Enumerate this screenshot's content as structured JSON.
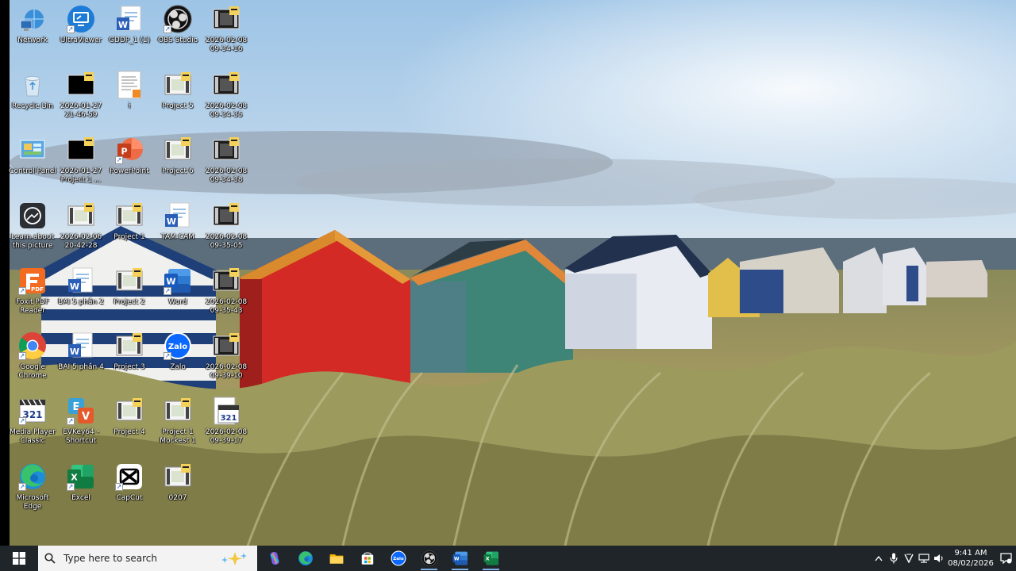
{
  "desktop": {
    "icons": [
      {
        "name": "network",
        "label": "Network",
        "kind": "network",
        "col": 0,
        "row": 0
      },
      {
        "name": "ultraviewer",
        "label": "UltraViewer",
        "kind": "ultraviewer",
        "col": 1,
        "row": 0,
        "shortcut": true
      },
      {
        "name": "gddp",
        "label": "GDDP_1 (1)",
        "kind": "word",
        "col": 2,
        "row": 0
      },
      {
        "name": "obs-studio",
        "label": "OBS Studio",
        "kind": "obs",
        "col": 3,
        "row": 0,
        "shortcut": true
      },
      {
        "name": "video-0908-34-16",
        "label": "2026-02-08 09-34-16",
        "kind": "video-dark",
        "col": 4,
        "row": 0
      },
      {
        "name": "recycle-bin",
        "label": "Recycle Bin",
        "kind": "recycle",
        "col": 0,
        "row": 1
      },
      {
        "name": "video-0127-21-46",
        "label": "2026-01-27 21-46-59",
        "kind": "video-black",
        "col": 1,
        "row": 1
      },
      {
        "name": "doc-i",
        "label": "i",
        "kind": "doc",
        "col": 2,
        "row": 1
      },
      {
        "name": "project-5",
        "label": "Project 5",
        "kind": "video-light",
        "col": 3,
        "row": 1
      },
      {
        "name": "video-0908-34-35",
        "label": "2026-02-08 09-34-35",
        "kind": "video-dark",
        "col": 4,
        "row": 1
      },
      {
        "name": "control-panel",
        "label": "Control Panel",
        "kind": "control",
        "col": 0,
        "row": 2
      },
      {
        "name": "video-0127-project1",
        "label": "2026-01-27 Project 1 ...",
        "kind": "video-black",
        "col": 1,
        "row": 2
      },
      {
        "name": "powerpoint",
        "label": "PowerPoint",
        "kind": "powerpoint",
        "col": 2,
        "row": 2,
        "shortcut": true
      },
      {
        "name": "project-6",
        "label": "Project 6",
        "kind": "video-light",
        "col": 3,
        "row": 2
      },
      {
        "name": "video-0908-34-38",
        "label": "2026-02-08 09-34-38",
        "kind": "video-dark",
        "col": 4,
        "row": 2
      },
      {
        "name": "learn-about-picture",
        "label": "Learn about this picture",
        "kind": "learn",
        "col": 0,
        "row": 3
      },
      {
        "name": "video-0206-20-42",
        "label": "2026-02-06 20-42-28",
        "kind": "video-light",
        "col": 1,
        "row": 3
      },
      {
        "name": "project-1",
        "label": "Project 1",
        "kind": "video-light",
        "col": 2,
        "row": 3
      },
      {
        "name": "tam-cam",
        "label": "TAM CAM",
        "kind": "word",
        "col": 3,
        "row": 3
      },
      {
        "name": "video-0908-35-05",
        "label": "2026-02-08 09-35-05",
        "kind": "video-dark",
        "col": 4,
        "row": 3
      },
      {
        "name": "foxit-pdf",
        "label": "Foxit PDF Reader",
        "kind": "foxit",
        "col": 0,
        "row": 4,
        "shortcut": true
      },
      {
        "name": "bai5-phan2",
        "label": "BAI 5 phần 2",
        "kind": "word",
        "col": 1,
        "row": 4
      },
      {
        "name": "project-2",
        "label": "Project 2",
        "kind": "video-light",
        "col": 2,
        "row": 4
      },
      {
        "name": "word",
        "label": "Word",
        "kind": "word-app",
        "col": 3,
        "row": 4,
        "shortcut": true
      },
      {
        "name": "video-0908-35-43",
        "label": "2026-02-08 09-35-43",
        "kind": "video-dark",
        "col": 4,
        "row": 4
      },
      {
        "name": "google-chrome",
        "label": "Google Chrome",
        "kind": "chrome",
        "col": 0,
        "row": 5,
        "shortcut": true
      },
      {
        "name": "bai5-phan4",
        "label": "BAI 5 phần 4",
        "kind": "word",
        "col": 1,
        "row": 5
      },
      {
        "name": "project-3",
        "label": "Project 3",
        "kind": "video-light",
        "col": 2,
        "row": 5
      },
      {
        "name": "zalo",
        "label": "Zalo",
        "kind": "zalo",
        "col": 3,
        "row": 5,
        "shortcut": true
      },
      {
        "name": "video-0908-39-10",
        "label": "2026-02-08 09-39-10",
        "kind": "video-dark",
        "col": 4,
        "row": 5
      },
      {
        "name": "media-player-classic",
        "label": "Media Player Classic",
        "kind": "mpc",
        "col": 0,
        "row": 6,
        "shortcut": true
      },
      {
        "name": "evkey64",
        "label": "EVKey64 - Shortcut",
        "kind": "evkey",
        "col": 1,
        "row": 6,
        "shortcut": true
      },
      {
        "name": "project-4",
        "label": "Project 4",
        "kind": "video-light",
        "col": 2,
        "row": 6
      },
      {
        "name": "project-1-mockest",
        "label": "Project 1 Mockest 1",
        "kind": "video-light",
        "col": 3,
        "row": 6
      },
      {
        "name": "video-0908-39-17",
        "label": "2026-02-08 09-39-17",
        "kind": "mpc-file",
        "col": 4,
        "row": 6
      },
      {
        "name": "microsoft-edge",
        "label": "Microsoft Edge",
        "kind": "edge",
        "col": 0,
        "row": 7,
        "shortcut": true
      },
      {
        "name": "excel",
        "label": "Excel",
        "kind": "excel",
        "col": 1,
        "row": 7,
        "shortcut": true
      },
      {
        "name": "capcut",
        "label": "CapCut",
        "kind": "capcut",
        "col": 2,
        "row": 7,
        "shortcut": true
      },
      {
        "name": "file-0207",
        "label": "0207",
        "kind": "video-light",
        "col": 3,
        "row": 7
      }
    ]
  },
  "taskbar": {
    "search_placeholder": "Type here to search",
    "apps": [
      {
        "name": "copilot",
        "kind": "copilot",
        "active": false
      },
      {
        "name": "edge",
        "kind": "edge",
        "active": false
      },
      {
        "name": "file-explorer",
        "kind": "folder",
        "active": false
      },
      {
        "name": "microsoft-store",
        "kind": "store",
        "active": false
      },
      {
        "name": "zalo",
        "kind": "zalo",
        "active": false
      },
      {
        "name": "obs",
        "kind": "obs",
        "active": true
      },
      {
        "name": "word",
        "kind": "word-app",
        "active": true
      },
      {
        "name": "excel",
        "kind": "excel",
        "active": true
      }
    ],
    "time": "9:41 AM",
    "date": "08/02/2026"
  },
  "colors": {
    "taskbar_bg": "#1f2528",
    "search_bg": "#f3f3f3",
    "active_indicator": "#7fb1e8"
  }
}
